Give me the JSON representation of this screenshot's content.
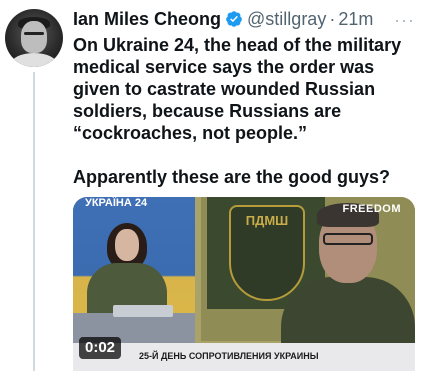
{
  "author": {
    "name": "Ian Miles Cheong",
    "handle": "@stillgray",
    "separator": "·",
    "time": "21m",
    "verified_color": "#1d9bf0"
  },
  "more_label": "···",
  "text": {
    "line1": "On Ukraine 24, the head of the military medical service says the order was given to castrate wounded Russian soldiers, because Russians are “cockroaches, not people.”",
    "line2": "Apparently these are the good guys?"
  },
  "media": {
    "channel_logo": "УКРАЇНА 24",
    "broadcaster": "FREEDOM",
    "emblem_text": "ПДМШ",
    "ticker": "25-Й ДЕНЬ СОПРОТИВЛЕНИЯ УКРАИНЫ",
    "duration": "0:02"
  },
  "colors": {
    "text": "#0f1419",
    "secondary": "#536471",
    "thread_line": "#cfd9de"
  },
  "icons": {
    "verified": "verified-badge-icon",
    "more": "more-dots-icon"
  }
}
